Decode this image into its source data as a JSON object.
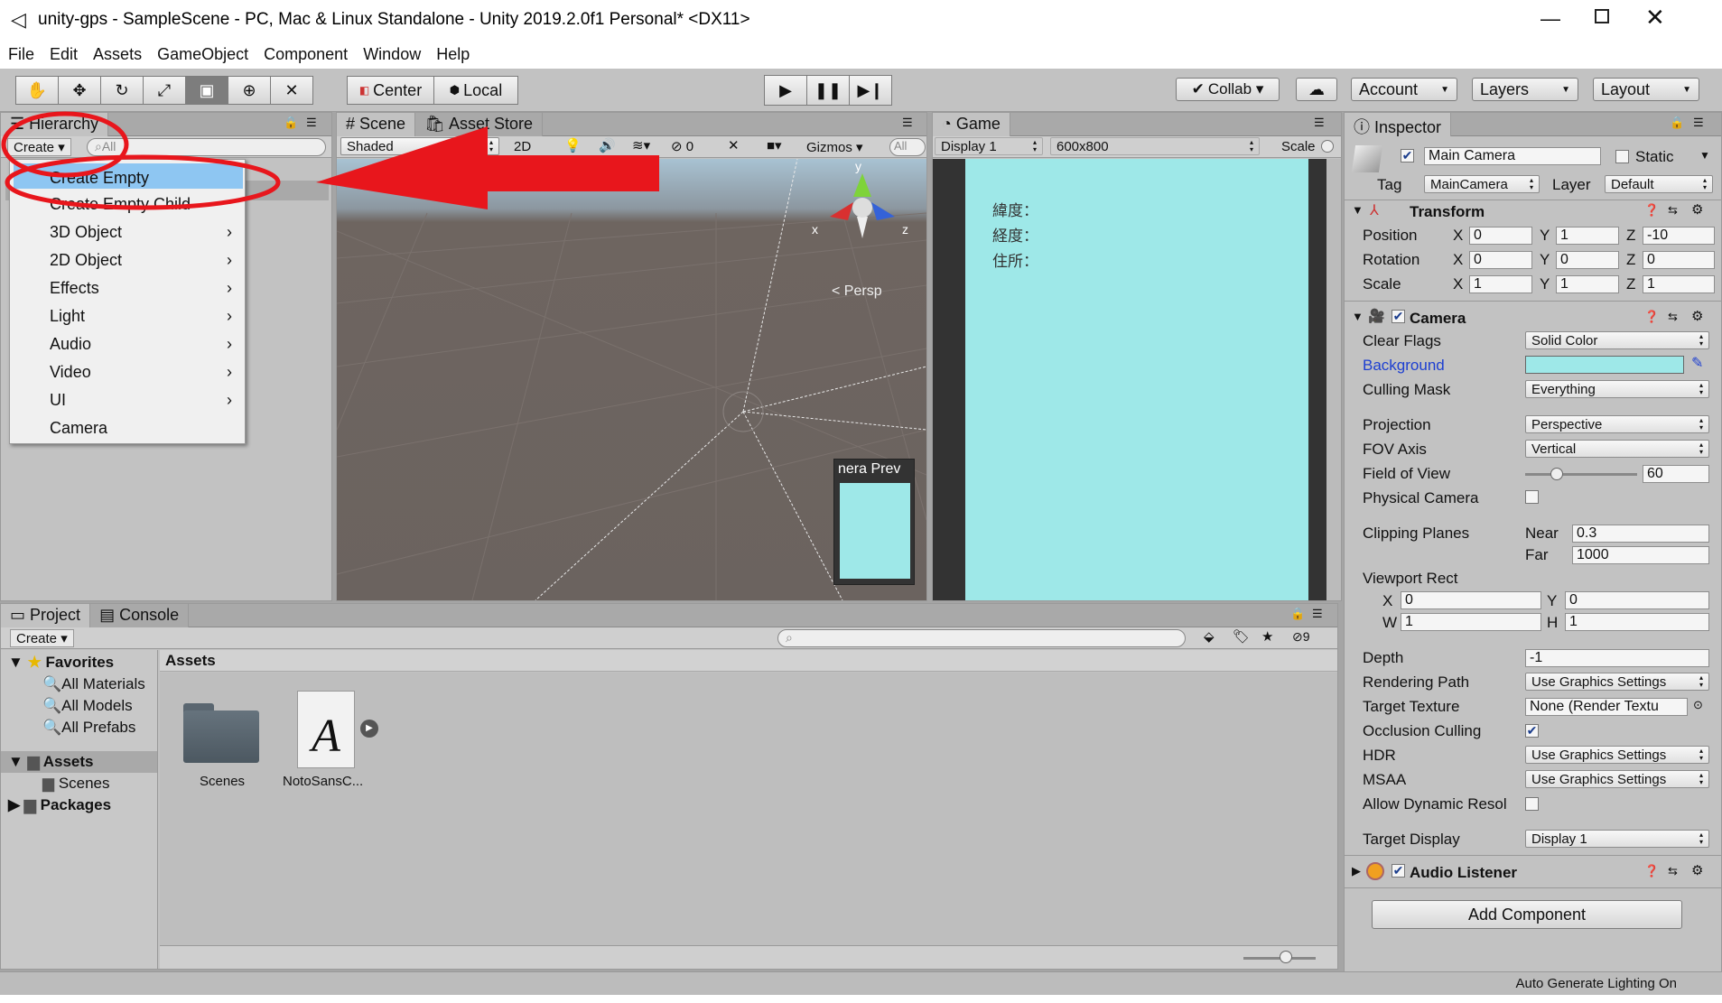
{
  "window": {
    "title": "unity-gps - SampleScene - PC, Mac & Linux Standalone - Unity 2019.2.0f1 Personal* <DX11>"
  },
  "menu": [
    "File",
    "Edit",
    "Assets",
    "GameObject",
    "Component",
    "Window",
    "Help"
  ],
  "toolbar": {
    "pivot": "Center",
    "space": "Local",
    "collab": "Collab",
    "account": "Account",
    "layers": "Layers",
    "layout": "Layout"
  },
  "hierarchy": {
    "tab": "Hierarchy",
    "create": "Create",
    "search_placeholder": "All"
  },
  "context_menu": {
    "items": [
      "Create Empty",
      "Create Empty Child",
      "3D Object",
      "2D Object",
      "Effects",
      "Light",
      "Audio",
      "Video",
      "UI",
      "Camera"
    ]
  },
  "scene": {
    "tab": "Scene",
    "tab2": "Asset Store",
    "shading": "Shaded",
    "mode2d": "2D",
    "hidden_count": "0",
    "gizmos": "Gizmos",
    "search": "All",
    "persp": "< Persp",
    "axis_y": "y",
    "axis_x": "x",
    "axis_z": "z",
    "cam_preview": "nera Prev"
  },
  "game": {
    "tab": "Game",
    "display": "Display 1",
    "resolution": "600x800",
    "scale": "Scale",
    "lines": [
      "緯度：",
      "経度：",
      "住所："
    ]
  },
  "inspector": {
    "tab": "Inspector",
    "name": "Main Camera",
    "static": "Static",
    "tag_label": "Tag",
    "tag": "MainCamera",
    "layer_label": "Layer",
    "layer": "Default",
    "transform": {
      "title": "Transform",
      "position": {
        "label": "Position",
        "x": "0",
        "y": "1",
        "z": "-10"
      },
      "rotation": {
        "label": "Rotation",
        "x": "0",
        "y": "0",
        "z": "0"
      },
      "scale": {
        "label": "Scale",
        "x": "1",
        "y": "1",
        "z": "1"
      }
    },
    "camera": {
      "title": "Camera",
      "clear_flags": "Clear Flags",
      "clear_flags_v": "Solid Color",
      "background": "Background",
      "culling": "Culling Mask",
      "culling_v": "Everything",
      "projection": "Projection",
      "projection_v": "Perspective",
      "fov_axis": "FOV Axis",
      "fov_axis_v": "Vertical",
      "fov": "Field of View",
      "fov_v": "60",
      "fov_fraction": 0.28,
      "physical": "Physical Camera",
      "clipping": "Clipping Planes",
      "near": "Near",
      "near_v": "0.3",
      "far": "Far",
      "far_v": "1000",
      "viewport": "Viewport Rect",
      "vx": "0",
      "vy": "0",
      "vw": "1",
      "vh": "1",
      "depth": "Depth",
      "depth_v": "-1",
      "rendering": "Rendering Path",
      "rendering_v": "Use Graphics Settings",
      "target_tex": "Target Texture",
      "target_tex_v": "None (Render Textu",
      "occlusion": "Occlusion Culling",
      "hdr": "HDR",
      "hdr_v": "Use Graphics Settings",
      "msaa": "MSAA",
      "msaa_v": "Use Graphics Settings",
      "dyn_res": "Allow Dynamic Resol",
      "target_disp": "Target Display",
      "target_disp_v": "Display 1"
    },
    "audio": {
      "title": "Audio Listener"
    },
    "add_component": "Add Component"
  },
  "project": {
    "tab": "Project",
    "tab2": "Console",
    "create": "Create",
    "hidden_count": "9",
    "favorites": "Favorites",
    "fav_items": [
      "All Materials",
      "All Models",
      "All Prefabs"
    ],
    "assets": "Assets",
    "scenes": "Scenes",
    "packages": "Packages",
    "header": "Assets",
    "items": [
      "Scenes",
      "NotoSansC..."
    ]
  },
  "status": {
    "text": "Auto Generate Lighting On"
  },
  "colors": {
    "game_bg": "#9ee8e8",
    "annotation": "#e8161c",
    "selection": "#8ec6f2"
  }
}
